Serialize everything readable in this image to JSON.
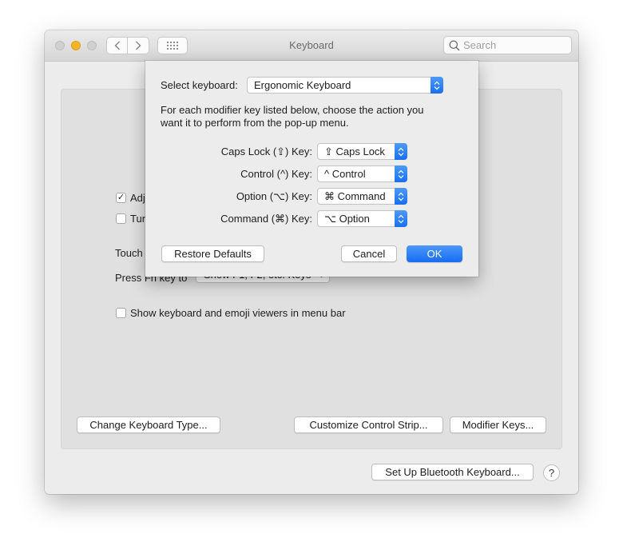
{
  "window": {
    "title": "Keyboard",
    "search_placeholder": "Search",
    "nav_back": "<",
    "nav_forward": ">"
  },
  "background": {
    "checkboxes": [
      {
        "label": "Adj",
        "checked": true
      },
      {
        "label": "Tur",
        "checked": false
      }
    ],
    "touch_label": "Touch",
    "press_fn_label": "Press Fn key to",
    "fn_select_value": "Show F1, F2, etc. Keys",
    "show_viewers": {
      "label": "Show keyboard and emoji viewers in menu bar",
      "checked": false
    },
    "buttons": {
      "change_type": "Change Keyboard Type...",
      "customize_strip": "Customize Control Strip...",
      "modifier_keys": "Modifier Keys...",
      "bluetooth": "Set Up Bluetooth Keyboard...",
      "help": "?"
    }
  },
  "sheet": {
    "select_keyboard_label": "Select keyboard:",
    "select_keyboard_value": "Ergonomic Keyboard",
    "instructions_line1": "For each modifier key listed below, choose the action you",
    "instructions_line2": "want it to perform from the pop-up menu.",
    "modifiers": [
      {
        "label": "Caps Lock (⇪) Key:",
        "value": "⇪ Caps Lock"
      },
      {
        "label": "Control (^) Key:",
        "value": "^ Control"
      },
      {
        "label": "Option (⌥) Key:",
        "value": "⌘ Command"
      },
      {
        "label": "Command (⌘) Key:",
        "value": "⌥ Option"
      }
    ],
    "restore_defaults": "Restore Defaults",
    "cancel": "Cancel",
    "ok": "OK"
  },
  "colors": {
    "accent": "#1a6ff0",
    "minimize_light": "#f6b428"
  }
}
